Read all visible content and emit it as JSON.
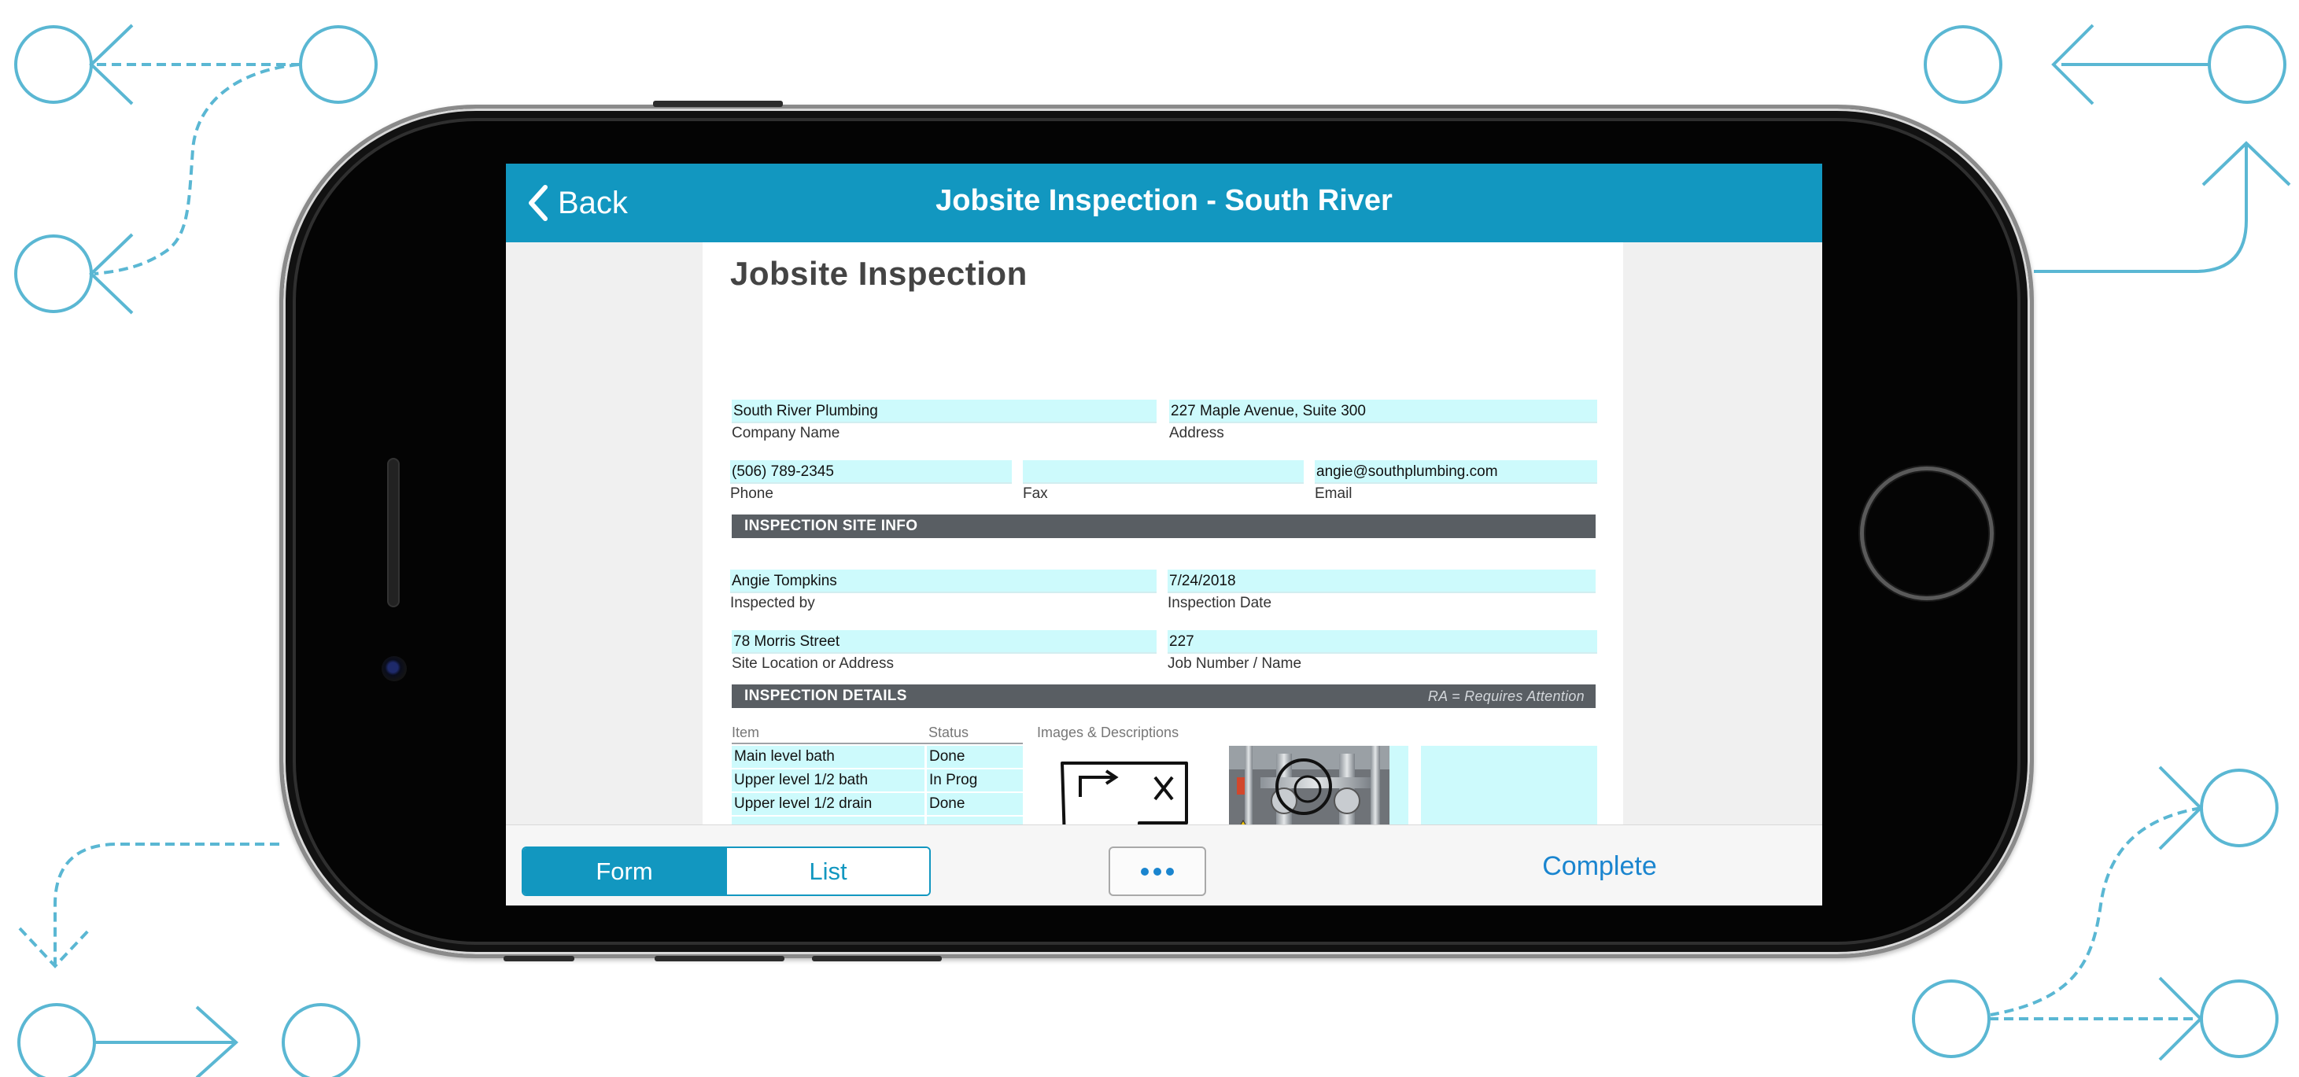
{
  "app": {
    "nav": {
      "back_label": "Back",
      "title": "Jobsite Inspection - South River"
    },
    "form": {
      "title": "Jobsite Inspection",
      "company": {
        "value": "South River Plumbing",
        "label": "Company Name"
      },
      "address": {
        "value": "227 Maple Avenue, Suite 300",
        "label": "Address"
      },
      "phone": {
        "value": "(506) 789-2345",
        "label": "Phone"
      },
      "fax": {
        "value": "",
        "label": "Fax"
      },
      "email": {
        "value": "angie@southplumbing.com",
        "label": "Email"
      },
      "site_info_header": "INSPECTION SITE INFO",
      "inspected_by": {
        "value": "Angie Tompkins",
        "label": "Inspected by"
      },
      "inspection_date": {
        "value": "7/24/2018",
        "label": "Inspection Date"
      },
      "site_location": {
        "value": "78 Morris Street",
        "label": "Site Location or Address"
      },
      "job_number": {
        "value": "227",
        "label": "Job Number / Name"
      },
      "details_header": "INSPECTION DETAILS",
      "details_note": "RA = Requires Attention",
      "table": {
        "col_item": "Item",
        "col_status": "Status",
        "col_images": "Images & Descriptions",
        "rows": [
          {
            "item": "Main level bath",
            "status": "Done"
          },
          {
            "item": "Upper level 1/2 bath",
            "status": "In Prog"
          },
          {
            "item": "Upper level 1/2 drain",
            "status": "Done"
          },
          {
            "item": "",
            "status": ""
          },
          {
            "item": "",
            "status": ""
          },
          {
            "item": "",
            "status": ""
          },
          {
            "item": "",
            "status": ""
          }
        ]
      }
    },
    "toolbar": {
      "form_label": "Form",
      "list_label": "List",
      "complete_label": "Complete"
    }
  },
  "colors": {
    "accent": "#1297c0",
    "field_fill": "#cdfafc",
    "section_bar": "#595e63",
    "decoration": "#5ab7d3"
  },
  "icons": [
    "back-chevron-icon",
    "more-ellipsis-icon",
    "sketch-image",
    "machinery-photo"
  ]
}
